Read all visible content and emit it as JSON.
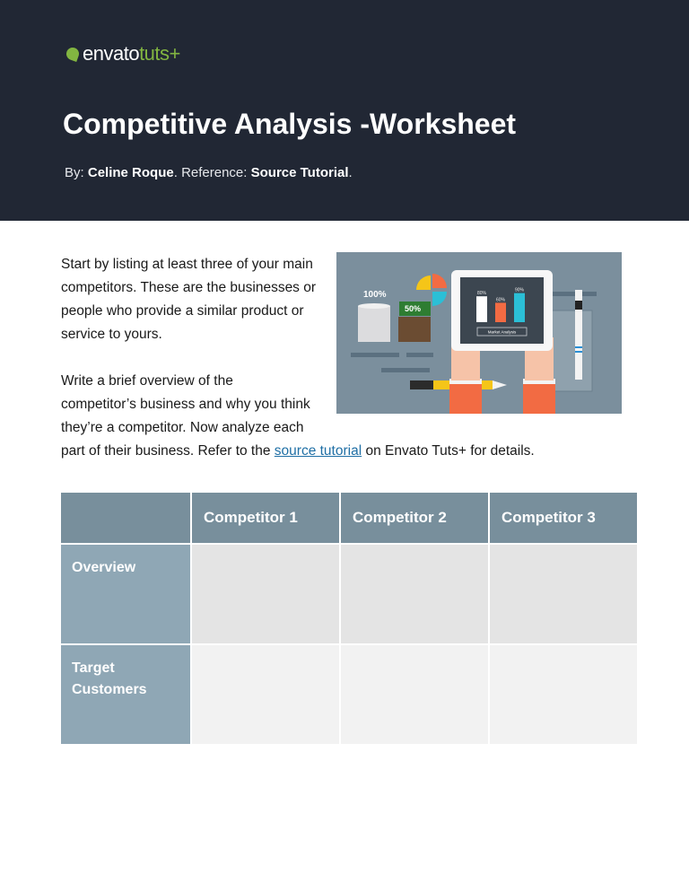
{
  "header": {
    "logo": {
      "brand": "envato",
      "product": "tuts+"
    },
    "title": "Competitive Analysis -Worksheet",
    "byline": {
      "by_label": "By:",
      "author": "Celine Roque",
      "reference_label": "Reference:",
      "reference": "Source Tutorial",
      "period": "."
    }
  },
  "intro": {
    "paragraph1": "Start by listing at least three of your main competitors. These are the businesses or people who provide a similar product or service to yours.",
    "paragraph2_lines": [
      "Write a brief overview of the",
      "competitor’s business and why you think",
      "they’re a competitor. Now analyze each"
    ],
    "paragraph2_last_before": "part of their business. Refer to the ",
    "paragraph2_link": "source tutorial",
    "paragraph2_last_after": " on Envato Tuts+ for details."
  },
  "illustration": {
    "cylinder_left_label": "100%",
    "cylinder_right_label": "50%",
    "tablet_bars": [
      {
        "label": "80%",
        "value": 80,
        "color": "#ffffff"
      },
      {
        "label": "60%",
        "value": 60,
        "color": "#f26b43"
      },
      {
        "label": "90%",
        "value": 90,
        "color": "#2bbfd6"
      }
    ],
    "tablet_button": "Market Analysis"
  },
  "table": {
    "columns": [
      "",
      "Competitor 1",
      "Competitor 2",
      "Competitor 3"
    ],
    "rows": [
      {
        "label": "Overview",
        "cells": [
          "",
          "",
          ""
        ]
      },
      {
        "label": "Target Customers",
        "cells": [
          "",
          "",
          ""
        ]
      }
    ]
  },
  "colors": {
    "header_bg": "#212734",
    "brand_green": "#82b541",
    "table_header": "#788f9c",
    "row_header": "#8fa7b5",
    "link": "#1f6fa5"
  }
}
